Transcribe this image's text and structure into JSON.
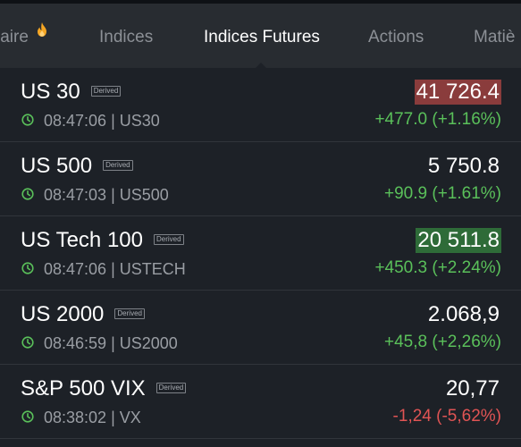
{
  "tabs": [
    {
      "label": "laire",
      "active": false,
      "hot": true
    },
    {
      "label": "Indices",
      "active": false
    },
    {
      "label": "Indices Futures",
      "active": true
    },
    {
      "label": "Actions",
      "active": false
    },
    {
      "label": "Matiè",
      "active": false
    }
  ],
  "derived_label": "Derived",
  "instruments": [
    {
      "name": "US 30",
      "time": "08:47:06",
      "symbol": "US30",
      "meta": "08:47:06 | US30",
      "price": "41 726.4",
      "change": "+477.0 (+1.16%)",
      "direction": "up",
      "flash": "down"
    },
    {
      "name": "US 500",
      "time": "08:47:03",
      "symbol": "US500",
      "meta": "08:47:03 | US500",
      "price": "5 750.8",
      "change": "+90.9 (+1.61%)",
      "direction": "up",
      "flash": "none"
    },
    {
      "name": "US Tech 100",
      "time": "08:47:06",
      "symbol": "USTECH",
      "meta": "08:47:06 | USTECH",
      "price": "20 511.8",
      "change": "+450.3 (+2.24%)",
      "direction": "up",
      "flash": "up"
    },
    {
      "name": "US 2000",
      "time": "08:46:59",
      "symbol": "US2000",
      "meta": "08:46:59 | US2000",
      "price": "2.068,9",
      "change": "+45,8 (+2,26%)",
      "direction": "up",
      "flash": "none"
    },
    {
      "name": "S&P 500 VIX",
      "time": "08:38:02",
      "symbol": "VX",
      "meta": "08:38:02 | VX",
      "price": "20,77",
      "change": "-1,24 (-5,62%)",
      "direction": "down",
      "flash": "none"
    }
  ],
  "colors": {
    "positive": "#5ac05a",
    "negative": "#e05454",
    "flash_down": "#8a3c3c",
    "flash_up": "#2e6b38",
    "clock": "#5ac05a",
    "fire": "#f5a623"
  },
  "icons": {
    "clock": "clock-icon",
    "hot": "fire-icon"
  }
}
